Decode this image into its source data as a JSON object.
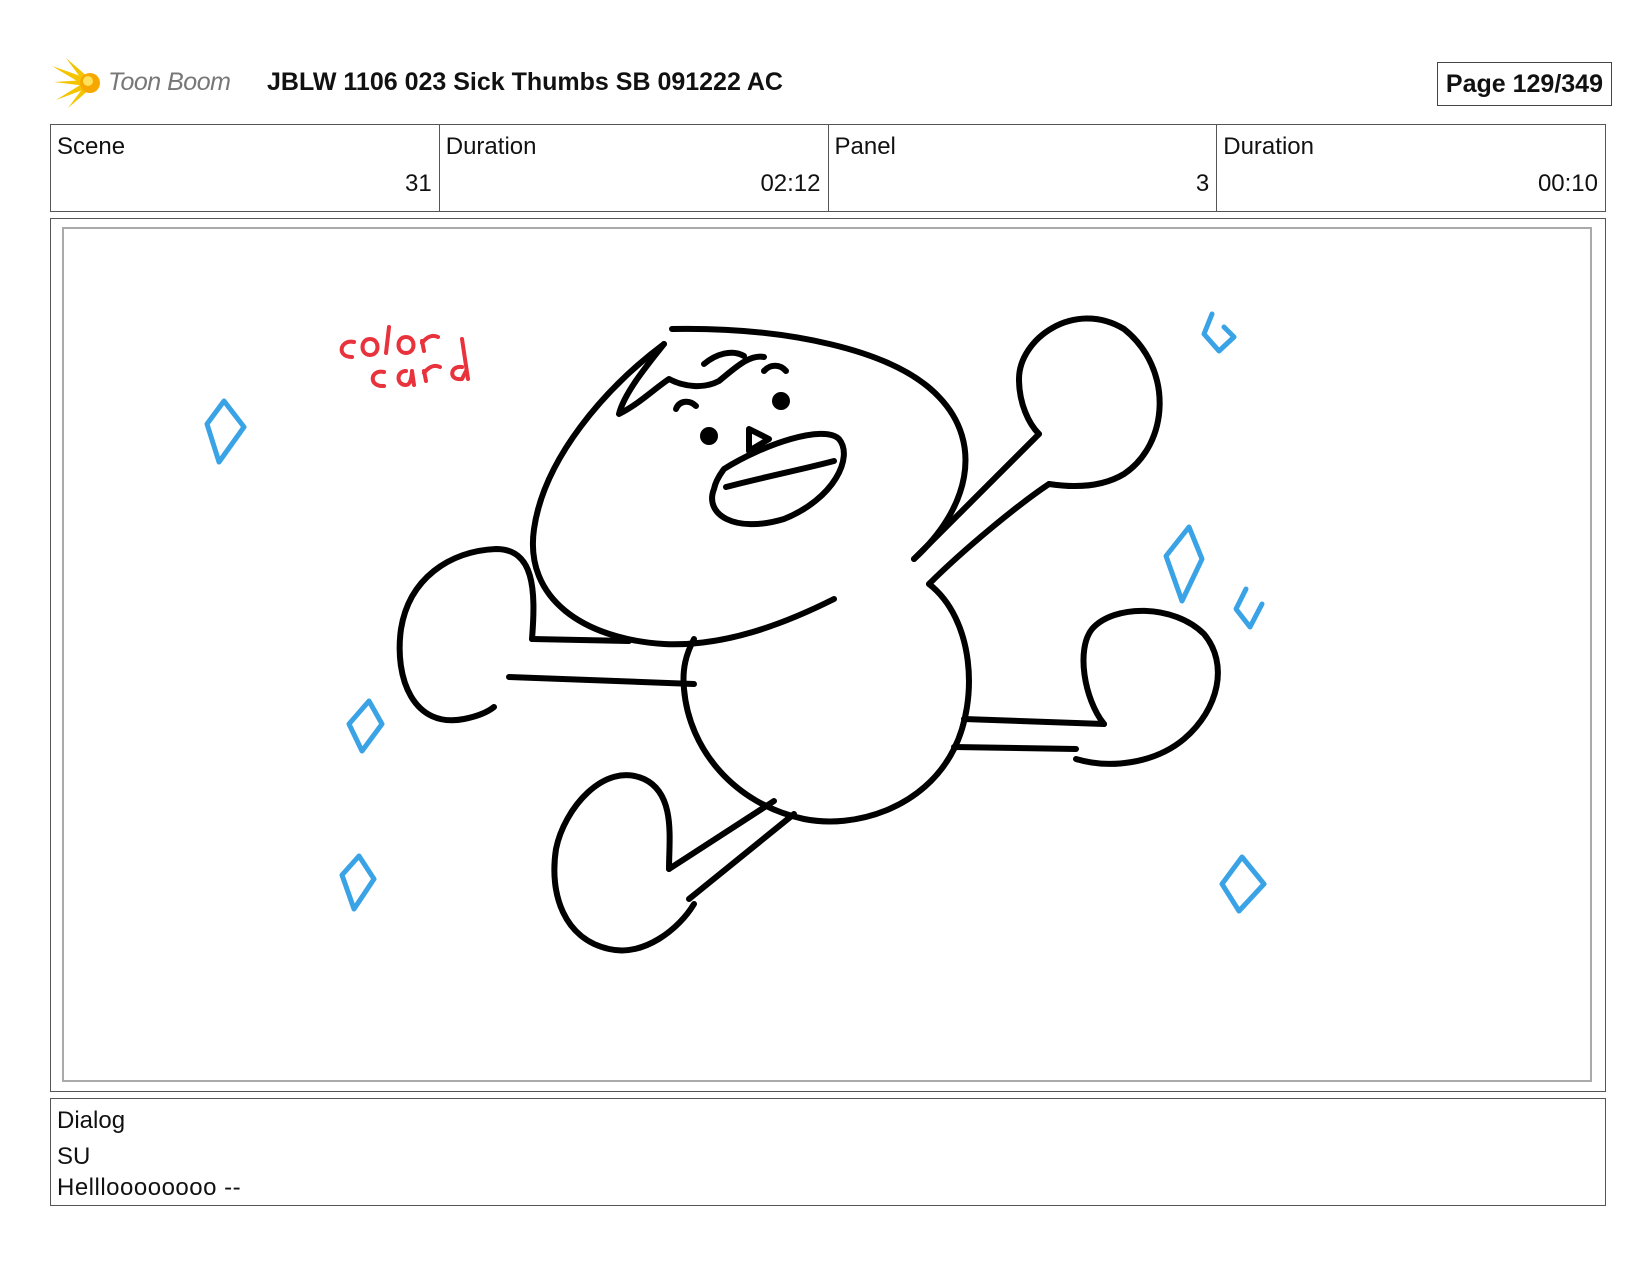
{
  "header": {
    "logo_text": "Toon Boom",
    "title": "JBLW 1106 023 Sick Thumbs SB 091222 AC",
    "page": "Page 129/349"
  },
  "info": {
    "scene_label": "Scene",
    "scene_value": "31",
    "scene_duration_label": "Duration",
    "scene_duration_value": "02:12",
    "panel_label": "Panel",
    "panel_value": "3",
    "panel_duration_label": "Duration",
    "panel_duration_value": "00:10"
  },
  "panel": {
    "annotation_text": "color card",
    "annotation_color": "#e8323c",
    "sparkle_color": "#3aa3e6",
    "line_color": "#000000"
  },
  "dialog": {
    "label": "Dialog",
    "speaker": "SU",
    "line": "Hellloooooooo --"
  }
}
